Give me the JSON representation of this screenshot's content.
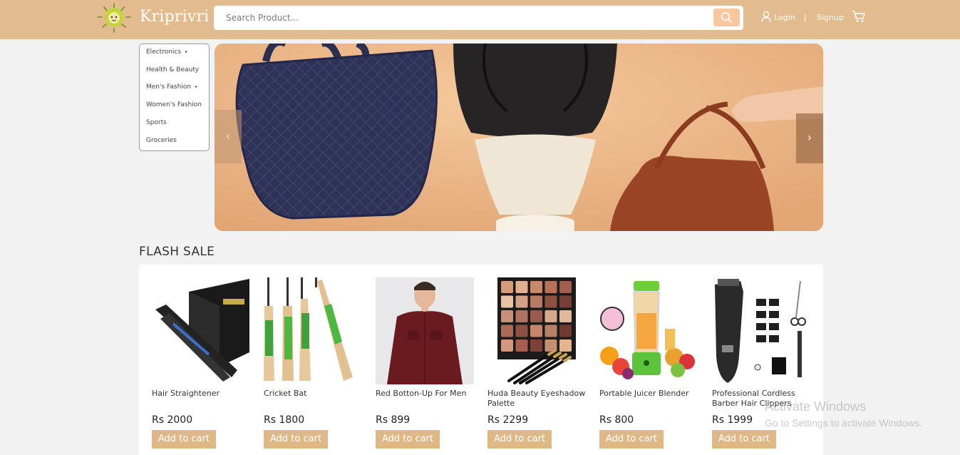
{
  "header": {
    "brand": "Kriprivri",
    "search_placeholder": "Search Product...",
    "login_label": "Login",
    "separator": "|",
    "signup_label": "Signup",
    "accent_color": "#e2bc8e"
  },
  "categories": [
    {
      "label": "Electronics",
      "arrow": "▸"
    },
    {
      "label": "Health & Beauty",
      "arrow": ""
    },
    {
      "label": "Men's Fashion",
      "arrow": "▸"
    },
    {
      "label": "Women's Fashion",
      "arrow": ""
    },
    {
      "label": "Sports",
      "arrow": ""
    },
    {
      "label": "Groceries",
      "arrow": ""
    }
  ],
  "carousel": {
    "prev_icon": "‹",
    "next_icon": "›"
  },
  "flash_sale": {
    "title": "FLASH SALE",
    "products": [
      {
        "name": "Hair Straightener",
        "price": "Rs 2000",
        "button": "Add to cart"
      },
      {
        "name": "Cricket Bat",
        "price": "Rs 1800",
        "button": "Add to cart"
      },
      {
        "name": "Red Botton-Up For Men",
        "price": "Rs 899",
        "button": "Add to cart"
      },
      {
        "name": "Huda Beauty Eyeshadow Palette",
        "price": "Rs 2299",
        "button": "Add to cart"
      },
      {
        "name": "Portable Juicer Blender",
        "price": "Rs 800",
        "button": "Add to cart"
      },
      {
        "name": "Professional Cordless Barber Hair Clippers",
        "price": "Rs 1999",
        "button": "Add to cart"
      }
    ]
  },
  "watermark": {
    "line1": "Activate Windows",
    "line2": "Go to Settings to activate Windows."
  }
}
